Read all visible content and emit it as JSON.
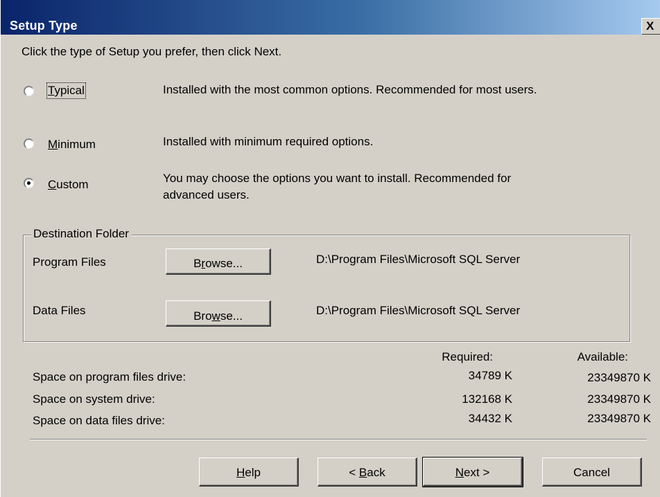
{
  "window": {
    "title": "Setup Type",
    "close_glyph": "X"
  },
  "instruction": "Click the type of Setup you prefer, then click Next.",
  "options": [
    {
      "label": "Typical",
      "mnemonic": "T",
      "label_rest": "ypical",
      "description": "Installed with the most common options. Recommended for most users.",
      "selected": false
    },
    {
      "label": "Minimum",
      "mnemonic": "M",
      "label_rest": "inimum",
      "description": "Installed with minimum required options.",
      "selected": false
    },
    {
      "label": "Custom",
      "mnemonic": "C",
      "label_rest": "ustom",
      "description_line1": "You may choose the options you want to install. Recommended for",
      "description_line2": "advanced users.",
      "selected": true
    }
  ],
  "destination": {
    "legend": "Destination Folder",
    "rows": [
      {
        "label": "Program Files",
        "button_pre": "B",
        "button_mnemonic": "r",
        "button_post": "owse...",
        "path": "D:\\Program Files\\Microsoft SQL Server"
      },
      {
        "label": "Data Files",
        "button_pre": "Bro",
        "button_mnemonic": "w",
        "button_post": "se...",
        "path": "D:\\Program Files\\Microsoft SQL Server"
      }
    ]
  },
  "space": {
    "required_header": "Required:",
    "available_header": "Available:",
    "rows": [
      {
        "label": "Space on program files drive:",
        "required": "34789 K",
        "available": "23349870 K"
      },
      {
        "label": "Space on system drive:",
        "required": "132168 K",
        "available": "23349870 K"
      },
      {
        "label": "Space on data files drive:",
        "required": "34432 K",
        "available": "23349870 K"
      }
    ]
  },
  "buttons": {
    "help": {
      "mnemonic": "H",
      "rest": "elp"
    },
    "back": {
      "pre": "< ",
      "mnemonic": "B",
      "rest": "ack"
    },
    "next": {
      "mnemonic": "N",
      "rest": "ext >"
    },
    "cancel": {
      "label": "Cancel"
    }
  }
}
